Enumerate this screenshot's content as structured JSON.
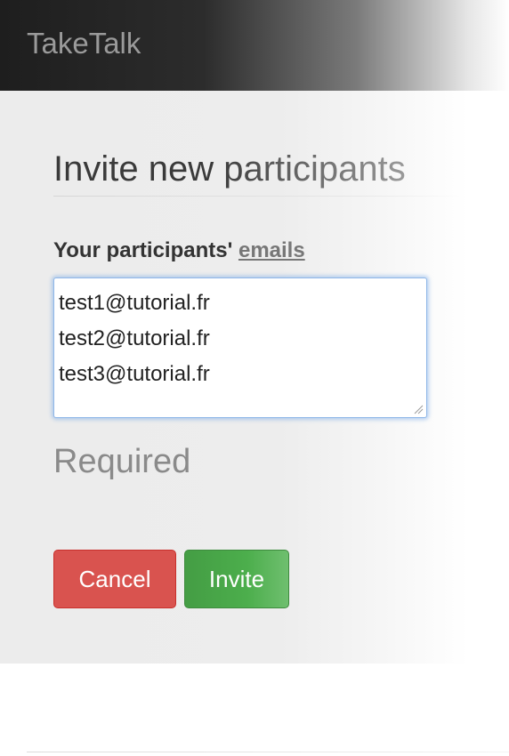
{
  "navbar": {
    "brand": "TakeTalk"
  },
  "form": {
    "title": "Invite new participants",
    "label_prefix": "Your participants' ",
    "label_link": "emails",
    "emails_value": "test1@tutorial.fr\ntest2@tutorial.fr\ntest3@tutorial.fr",
    "help_text": "Required"
  },
  "buttons": {
    "cancel_label": "Cancel",
    "invite_label": "Invite"
  },
  "colors": {
    "cancel": "#d9534f",
    "invite": "#4cae4c",
    "focus": "#66a0e6"
  }
}
